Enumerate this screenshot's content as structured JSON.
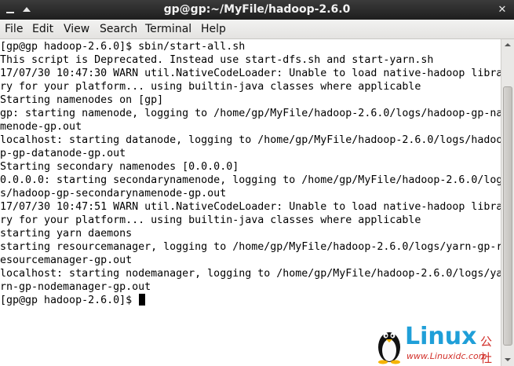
{
  "window": {
    "title": "gp@gp:~/MyFile/hadoop-2.6.0",
    "minimize_icon": "minimize-icon",
    "maximize_icon": "maximize-icon",
    "close_icon": "close-icon",
    "close_glyph": "✕"
  },
  "menu": {
    "file": "File",
    "edit": "Edit",
    "view": "View",
    "search": "Search",
    "terminal": "Terminal",
    "help": "Help"
  },
  "terminal": {
    "lines": [
      "[gp@gp hadoop-2.6.0]$ sbin/start-all.sh",
      "This script is Deprecated. Instead use start-dfs.sh and start-yarn.sh",
      "17/07/30 10:47:30 WARN util.NativeCodeLoader: Unable to load native-hadoop libra",
      "ry for your platform... using builtin-java classes where applicable",
      "Starting namenodes on [gp]",
      "gp: starting namenode, logging to /home/gp/MyFile/hadoop-2.6.0/logs/hadoop-gp-na",
      "menode-gp.out",
      "localhost: starting datanode, logging to /home/gp/MyFile/hadoop-2.6.0/logs/hadoo",
      "p-gp-datanode-gp.out",
      "Starting secondary namenodes [0.0.0.0]",
      "0.0.0.0: starting secondarynamenode, logging to /home/gp/MyFile/hadoop-2.6.0/log",
      "s/hadoop-gp-secondarynamenode-gp.out",
      "17/07/30 10:47:51 WARN util.NativeCodeLoader: Unable to load native-hadoop libra",
      "ry for your platform... using builtin-java classes where applicable",
      "starting yarn daemons",
      "starting resourcemanager, logging to /home/gp/MyFile/hadoop-2.6.0/logs/yarn-gp-r",
      "esourcemanager-gp.out",
      "localhost: starting nodemanager, logging to /home/gp/MyFile/hadoop-2.6.0/logs/ya",
      "rn-gp-nodemanager-gp.out"
    ],
    "prompt": "[gp@gp hadoop-2.6.0]$ "
  },
  "watermark": {
    "brand": "Linux",
    "cn": "公社",
    "url": "www.Linuxidc.com"
  },
  "colors": {
    "titlebar": "#2a2a2a",
    "menubar": "#ebeae8",
    "terminal_bg": "#ffffff",
    "terminal_fg": "#000000",
    "watermark_blue": "#1f9fd8",
    "watermark_red": "#d2302a"
  }
}
